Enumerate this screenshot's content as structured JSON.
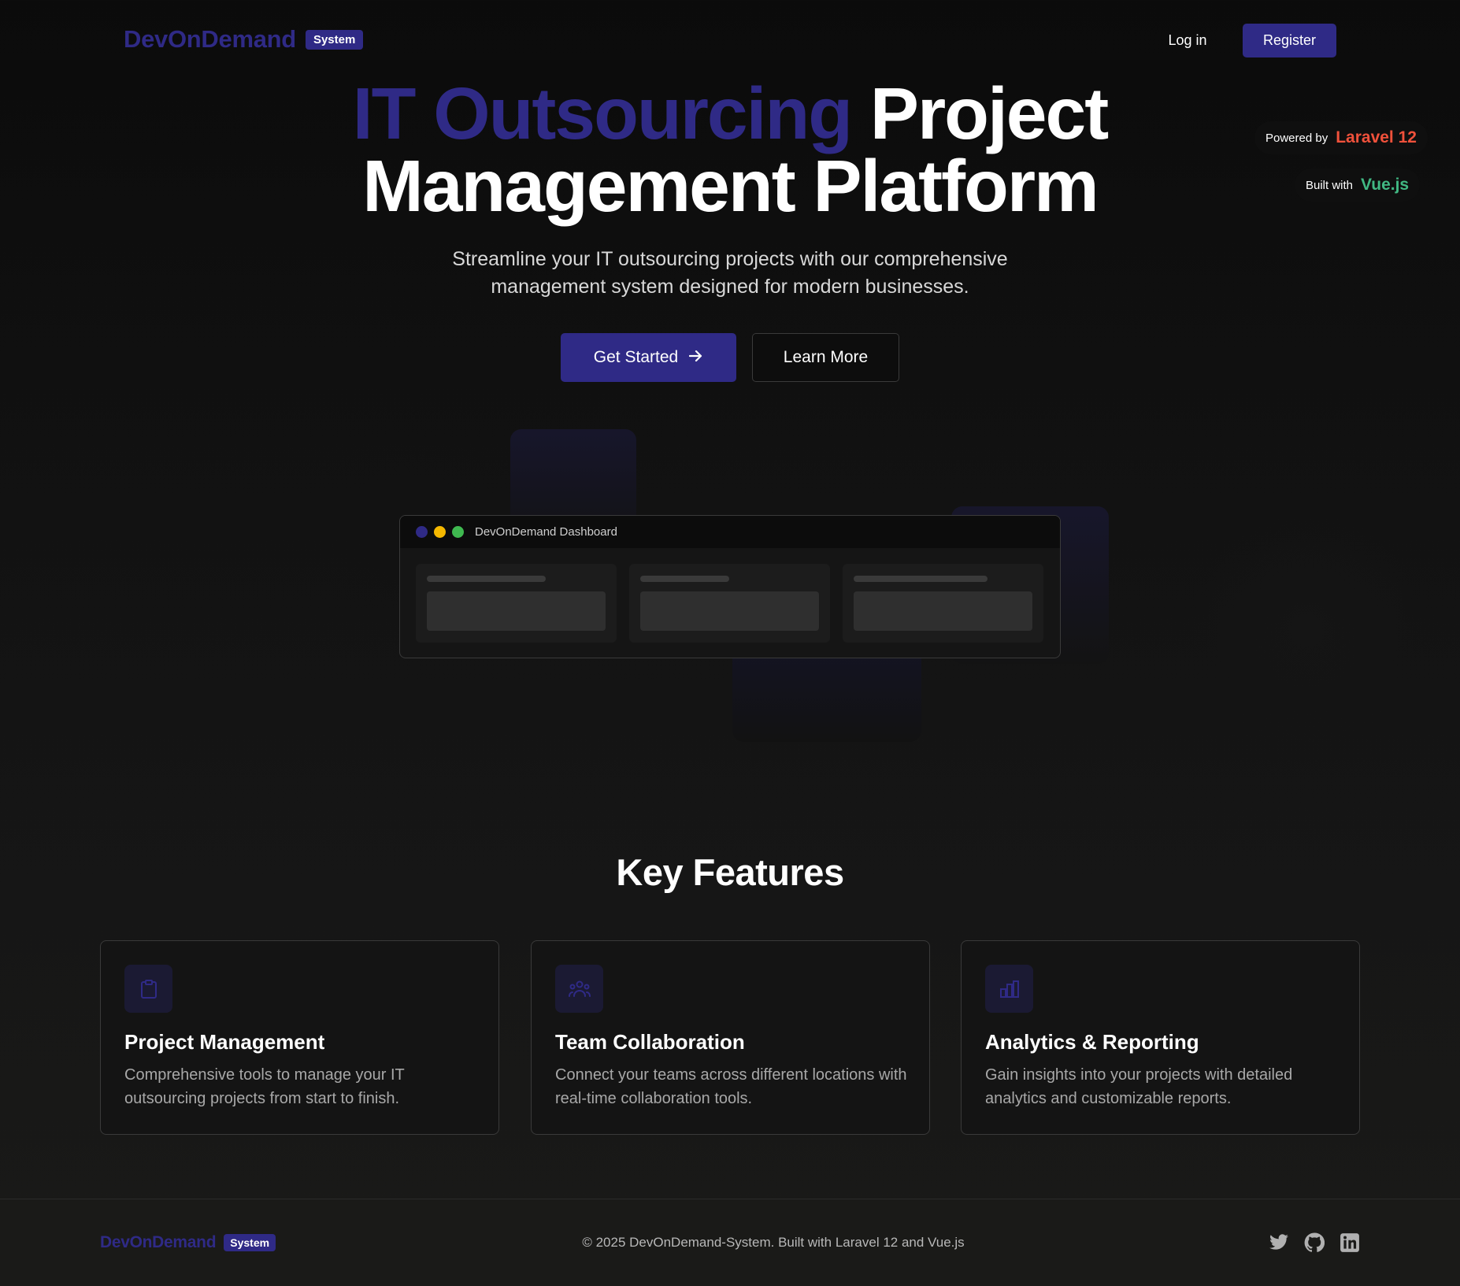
{
  "nav": {
    "brand": "DevOnDemand",
    "brand_badge": "System",
    "login_label": "Log in",
    "register_label": "Register"
  },
  "badges": {
    "powered_by_label": "Powered by",
    "powered_by_value": "Laravel 12",
    "built_with_label": "Built with",
    "built_with_value": "Vue.js"
  },
  "hero": {
    "title_accent": "IT Outsourcing",
    "title_rest_line1": "Project",
    "title_line2": "Management Platform",
    "subtitle": "Streamline your IT outsourcing projects with our comprehensive management system designed for modern businesses.",
    "primary_cta": "Get Started",
    "primary_cta_icon": "arrow-right-icon",
    "secondary_cta": "Learn More"
  },
  "dashboard_preview": {
    "title": "DevOnDemand Dashboard"
  },
  "features": {
    "title": "Key Features",
    "items": [
      {
        "icon": "clipboard-icon",
        "title": "Project Management",
        "description": "Comprehensive tools to manage your IT outsourcing projects from start to finish."
      },
      {
        "icon": "team-icon",
        "title": "Team Collaboration",
        "description": "Connect your teams across different locations with real-time collaboration tools."
      },
      {
        "icon": "bar-chart-icon",
        "title": "Analytics & Reporting",
        "description": "Gain insights into your projects with detailed analytics and customizable reports."
      }
    ]
  },
  "footer": {
    "brand": "DevOnDemand",
    "brand_badge": "System",
    "copyright": "© 2025 DevOnDemand-System. Built with Laravel 12 and Vue.js",
    "socials": [
      "twitter-icon",
      "github-icon",
      "linkedin-icon"
    ]
  },
  "colors": {
    "accent": "#2f2a86",
    "laravel": "#f0513b",
    "vue": "#41b883",
    "background": "#0b0b0b"
  }
}
